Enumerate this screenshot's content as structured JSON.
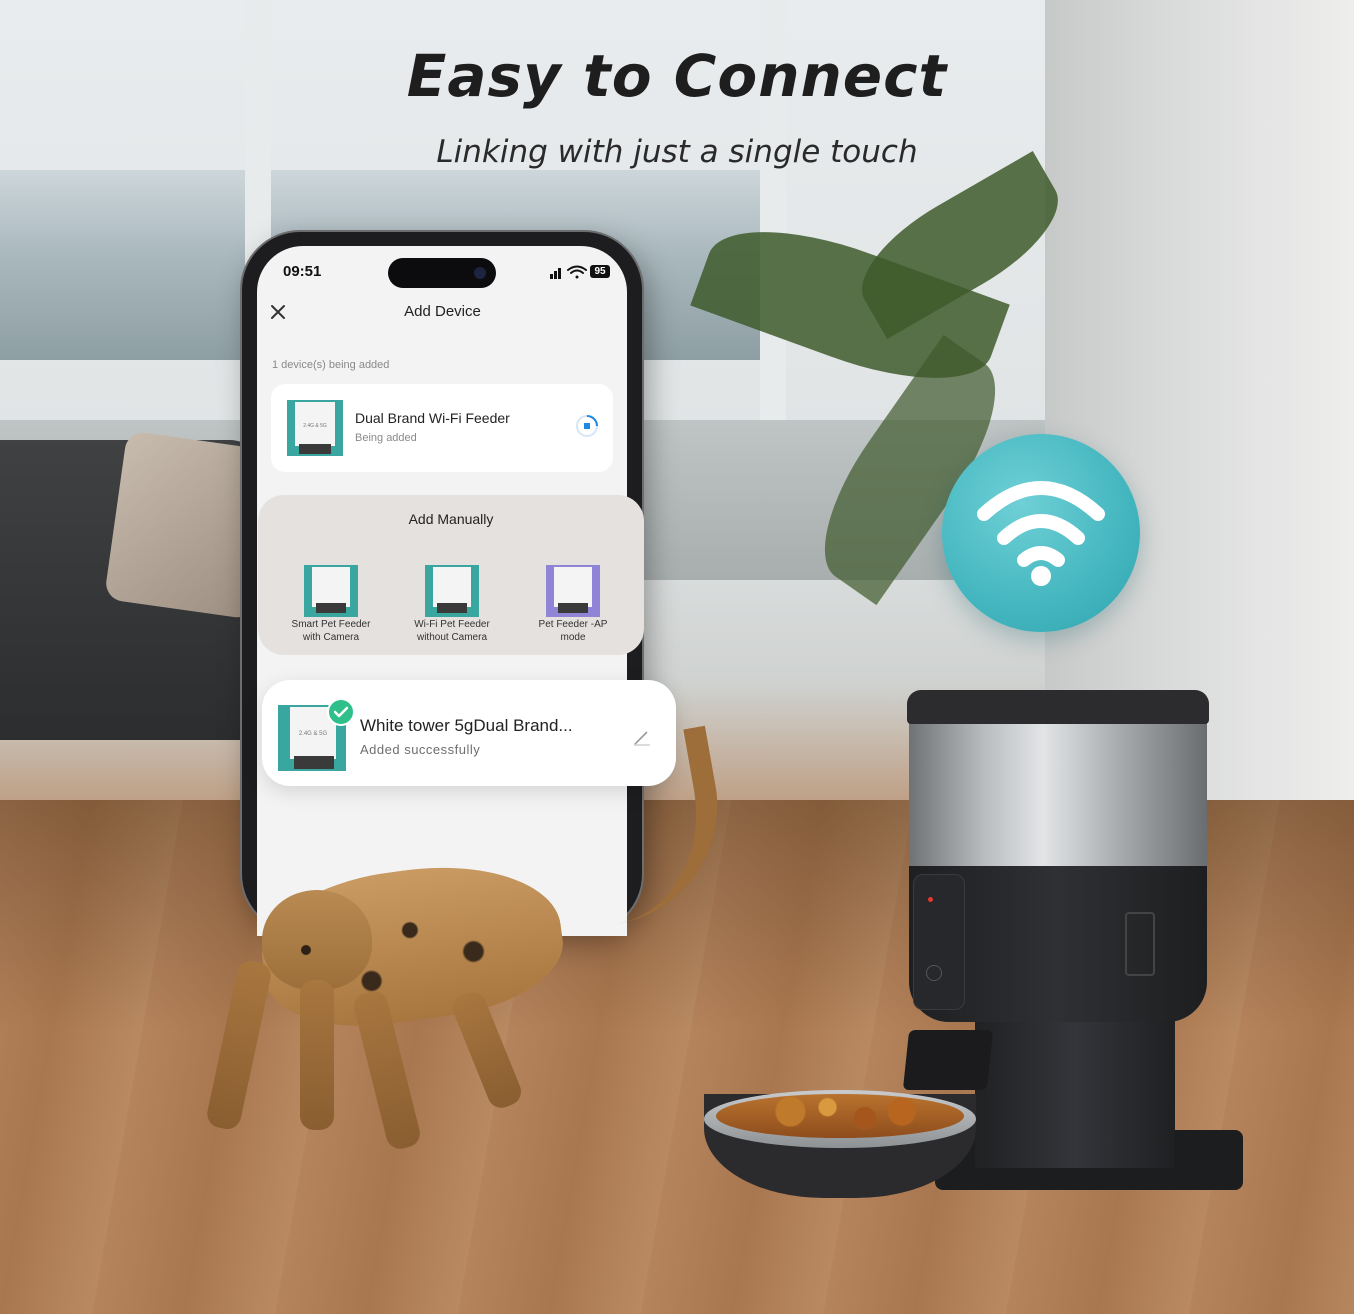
{
  "hero": {
    "title": "Easy to Connect",
    "subtitle": "Linking with just a single touch"
  },
  "phone": {
    "status_time": "09:51",
    "battery": "95",
    "nav_title": "Add Device",
    "being_added_note": "1 device(s) being added",
    "device_card": {
      "name": "Dual Brand Wi-Fi Feeder",
      "status": "Being added",
      "thumb_label": "2.4G & 5G"
    },
    "add_manually": {
      "title": "Add Manually",
      "options": [
        {
          "label_line1": "Smart Pet Feeder",
          "label_line2": "with Camera"
        },
        {
          "label_line1": "Wi-Fi Pet Feeder",
          "label_line2": "without Camera"
        },
        {
          "label_line1": "Pet Feeder -AP",
          "label_line2": "mode"
        }
      ]
    },
    "success_card": {
      "name": "White tower 5gDual Brand...",
      "status": "Added successfully",
      "thumb_label": "2.4G & 5G"
    }
  },
  "colors": {
    "accent_teal": "#39a6a0",
    "success_green": "#2fbf8a",
    "spinner_blue": "#1e88e5",
    "wifi_badge": "#44b6bf"
  },
  "icons": [
    "close-icon",
    "signal-icon",
    "wifi-icon",
    "battery-icon",
    "spinner-icon",
    "check-icon",
    "edit-icon",
    "wifi-badge-icon"
  ]
}
